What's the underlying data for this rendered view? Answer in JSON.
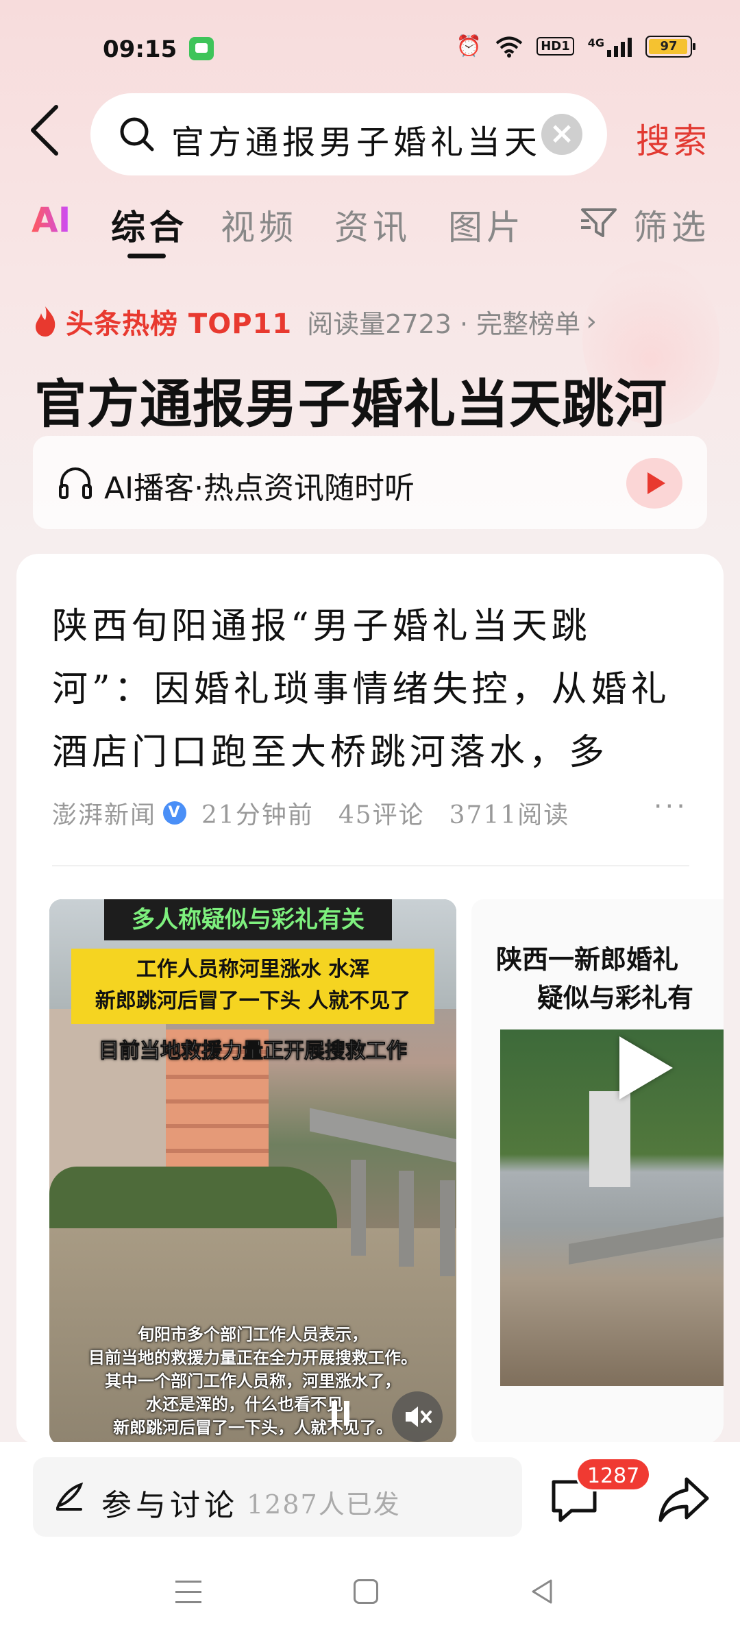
{
  "status_bar": {
    "time": "09:15",
    "icons": [
      "message-icon",
      "alarm-icon",
      "wifi-icon",
      "hd-icon",
      "signal-icon",
      "battery-icon"
    ],
    "hd_label": "HD1",
    "network_label": "4G",
    "battery": "97"
  },
  "search": {
    "query": "官方通报男子婚礼当天",
    "search_label": "搜索"
  },
  "tabs": [
    {
      "label": "AI"
    },
    {
      "label": "综合",
      "active": true
    },
    {
      "label": "视频"
    },
    {
      "label": "资讯"
    },
    {
      "label": "图片"
    },
    {
      "label": "筛选"
    }
  ],
  "hot": {
    "tag": "头条热榜 TOP11",
    "reads": "阅读量2723 · 完整榜单",
    "title": "官方通报男子婚礼当天跳河"
  },
  "podcast": {
    "label": "AI播客·热点资讯随时听"
  },
  "article": {
    "title": "陕西旬阳通报“男子婚礼当天跳河”：因婚礼琐事情绪失控，从婚礼酒店门口跑至大桥跳河落水，多部...",
    "source": "澎湃新闻",
    "verified": "V",
    "time": "21分钟前",
    "comments": "45评论",
    "reads": "3711阅读",
    "more": "···"
  },
  "media": {
    "video1": {
      "banner_dark": "多人称疑似与彩礼有关",
      "banner_yellow_1": "工作人员称河里涨水 水浑",
      "banner_yellow_2": "新郎跳河后冒了一下头 人就不见了",
      "banner_line": "目前当地救援力量正开展搜救工作",
      "subtitle_1": "旬阳市多个部门工作人员表示，",
      "subtitle_2": "目前当地的救援力量正在全力开展搜救工作。",
      "subtitle_3": "其中一个部门工作人员称，河里涨水了，",
      "subtitle_4": "水还是浑的，什么也看不见，",
      "subtitle_5": "新郎跳河后冒了一下头，人就不见了。"
    },
    "video2": {
      "caption_1": "陕西一新郎婚礼",
      "caption_2": "疑似与彩礼有"
    }
  },
  "bottom": {
    "discuss_label": "参与讨论",
    "discuss_count": "1287人已发",
    "comment_badge": "1287"
  },
  "colors": {
    "accent_red": "#e23a32",
    "badge_red": "#f03a32",
    "verify_blue": "#4a8ff7"
  }
}
